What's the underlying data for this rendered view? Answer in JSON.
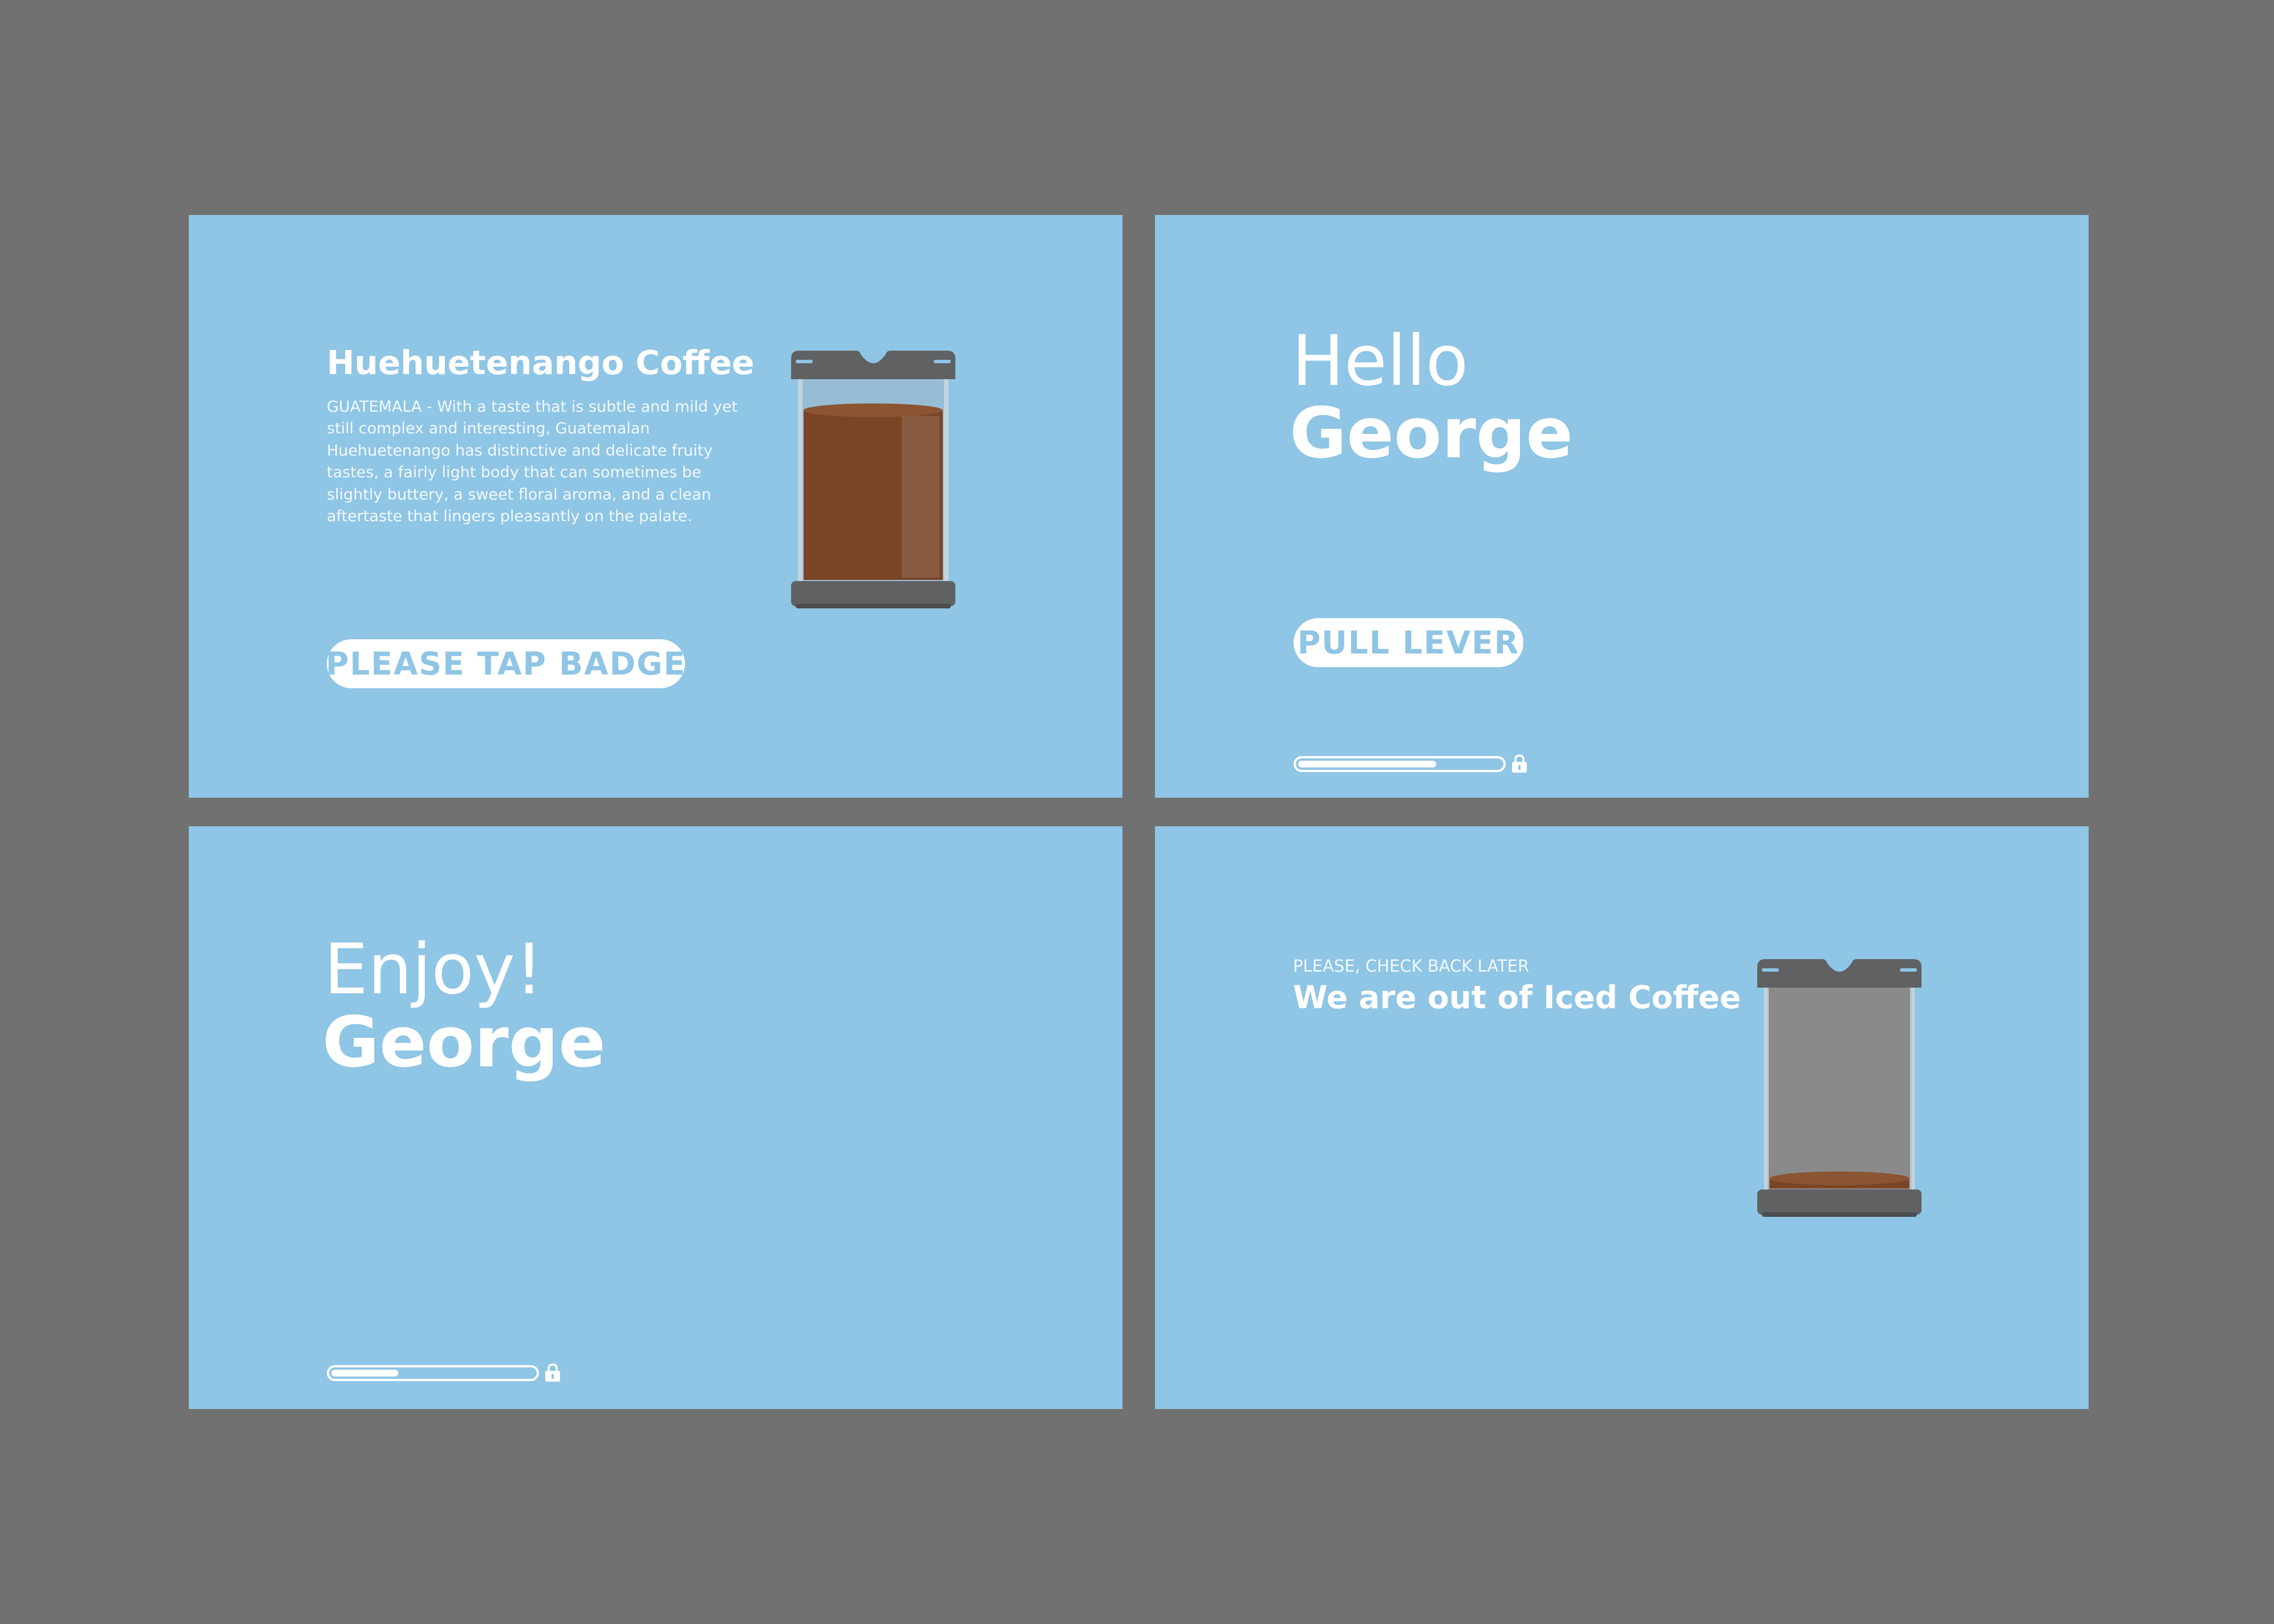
{
  "screen_coffee_info": {
    "title": "Huehuetenango Coffee",
    "description": "GUATEMALA - With a taste that is subtle and mild yet still complex and interesting, Guatemalan Huehuetenango has distinctive and delicate fruity tastes, a fairly light body that can sometimes be slightly buttery, a sweet floral aroma, and a clean aftertaste that lingers pleasantly on the palate.",
    "button_label": "PLEASE TAP BADGE",
    "canister_fill_fraction": 0.85,
    "canister_icon": "coffee-canister-icon"
  },
  "screen_hello": {
    "greeting": "Hello",
    "name": "George",
    "button_label": "PULL LEVER",
    "progress_fraction": 0.68,
    "lock_icon": "lock-icon"
  },
  "screen_enjoy": {
    "greeting": "Enjoy!",
    "name": "George",
    "progress_fraction": 0.33,
    "lock_icon": "lock-icon"
  },
  "screen_out_of_stock": {
    "subtitle": "PLEASE, CHECK BACK LATER",
    "title": "We are out of Iced Coffee",
    "canister_fill_fraction": 0.05,
    "canister_icon": "empty-canister-icon"
  },
  "colors": {
    "background": "#717171",
    "panel": "#8fc5e5",
    "text": "#ffffff",
    "coffee": "#7a4526",
    "canister_frame": "#5f6163",
    "empty_glass": "#8a8a8a"
  }
}
